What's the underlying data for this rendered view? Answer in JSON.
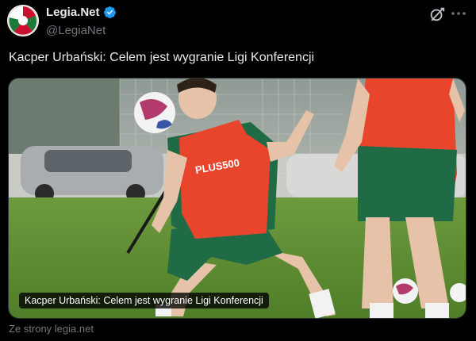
{
  "account": {
    "display_name": "Legia.Net",
    "handle": "@LegiaNet",
    "verified": true,
    "avatar_icon": "legia-net-logo-icon"
  },
  "tweet": {
    "text": "Kacper Urbański: Celem jest wygranie Ligi Konferencji"
  },
  "link_card": {
    "image_description_icon": "football-training-photo",
    "caption": "Kacper Urbański: Celem jest wygranie Ligi Konferencji",
    "source": "Ze strony legia.net"
  },
  "photo_sign": {
    "sponsor_text": "PLUS500"
  },
  "colors": {
    "background": "#000000",
    "text_primary": "#e7e9ea",
    "text_secondary": "#71767b",
    "verified": "#1d9bf0",
    "bib_orange": "#e8452c",
    "shirt_green": "#1f6b46"
  }
}
